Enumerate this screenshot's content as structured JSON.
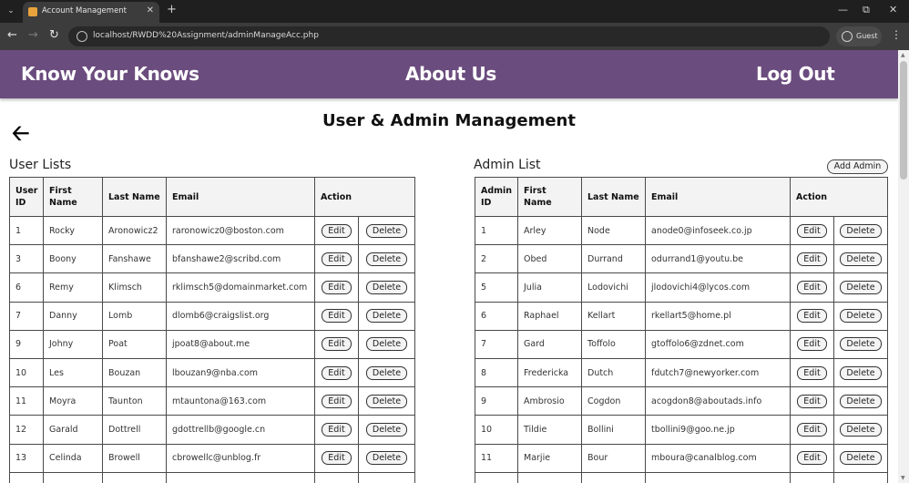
{
  "browser": {
    "tab_title": "Account Management",
    "url": "localhost/RWDD%20Assignment/adminManageAcc.php",
    "profile_label": "Guest"
  },
  "nav": {
    "brand": "Know Your Knows",
    "about": "About Us",
    "logout": "Log Out",
    "background_color": "#6b4c7e"
  },
  "page": {
    "title": "User & Admin Management"
  },
  "user_list": {
    "title": "User Lists",
    "headers": [
      "User ID",
      "First Name",
      "Last Name",
      "Email",
      "Action"
    ],
    "edit_label": "Edit",
    "delete_label": "Delete",
    "rows": [
      {
        "id": "1",
        "first": "Rocky",
        "last": "Aronowicz2",
        "email": "raronowicz0@boston.com"
      },
      {
        "id": "3",
        "first": "Boony",
        "last": "Fanshawe",
        "email": "bfanshawe2@scribd.com"
      },
      {
        "id": "6",
        "first": "Remy",
        "last": "Klimsch",
        "email": "rklimsch5@domainmarket.com"
      },
      {
        "id": "7",
        "first": "Danny",
        "last": "Lomb",
        "email": "dlomb6@craigslist.org"
      },
      {
        "id": "9",
        "first": "Johny",
        "last": "Poat",
        "email": "jpoat8@about.me"
      },
      {
        "id": "10",
        "first": "Les",
        "last": "Bouzan",
        "email": "lbouzan9@nba.com"
      },
      {
        "id": "11",
        "first": "Moyra",
        "last": "Taunton",
        "email": "mtauntona@163.com"
      },
      {
        "id": "12",
        "first": "Garald",
        "last": "Dottrell",
        "email": "gdottrellb@google.cn"
      },
      {
        "id": "13",
        "first": "Celinda",
        "last": "Browell",
        "email": "cbrowellc@unblog.fr"
      }
    ]
  },
  "admin_list": {
    "title": "Admin List",
    "add_label": "Add Admin",
    "headers": [
      "Admin ID",
      "First Name",
      "Last Name",
      "Email",
      "Action"
    ],
    "edit_label": "Edit",
    "delete_label": "Delete",
    "rows": [
      {
        "id": "1",
        "first": "Arley",
        "last": "Node",
        "email": "anode0@infoseek.co.jp"
      },
      {
        "id": "2",
        "first": "Obed",
        "last": "Durrand",
        "email": "odurrand1@youtu.be"
      },
      {
        "id": "5",
        "first": "Julia",
        "last": "Lodovichi",
        "email": "jlodovichi4@lycos.com"
      },
      {
        "id": "6",
        "first": "Raphael",
        "last": "Kellart",
        "email": "rkellart5@home.pl"
      },
      {
        "id": "7",
        "first": "Gard",
        "last": "Toffolo",
        "email": "gtoffolo6@zdnet.com"
      },
      {
        "id": "8",
        "first": "Fredericka",
        "last": "Dutch",
        "email": "fdutch7@newyorker.com"
      },
      {
        "id": "9",
        "first": "Ambrosio",
        "last": "Cogdon",
        "email": "acogdon8@aboutads.info"
      },
      {
        "id": "10",
        "first": "Tildie",
        "last": "Bollini",
        "email": "tbollini9@goo.ne.jp"
      },
      {
        "id": "11",
        "first": "Marjie",
        "last": "Bour",
        "email": "mboura@canalblog.com"
      }
    ]
  }
}
